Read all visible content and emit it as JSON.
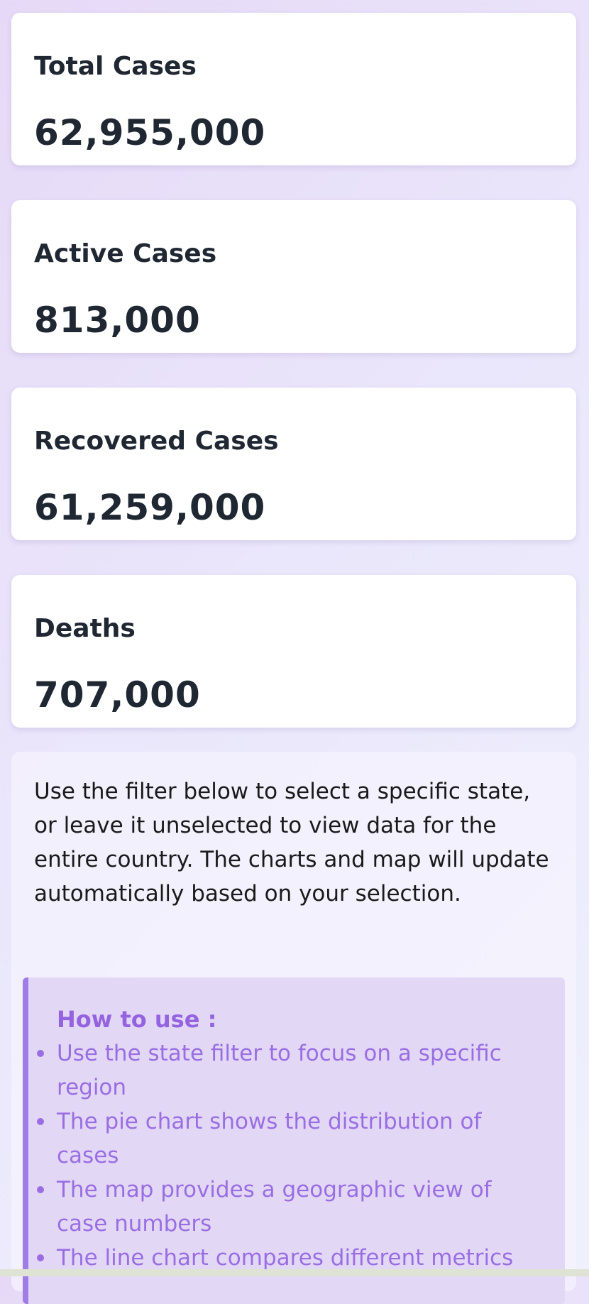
{
  "stats": [
    {
      "label": "Total Cases",
      "value": "62,955,000"
    },
    {
      "label": "Active Cases",
      "value": "813,000"
    },
    {
      "label": "Recovered Cases",
      "value": "61,259,000"
    },
    {
      "label": "Deaths",
      "value": "707,000"
    }
  ],
  "info": {
    "description": "Use the filter below to select a specific state, or leave it unselected to view data for the entire country. The charts and map will update automatically based on your selection.",
    "howto": {
      "title": "How to use :",
      "items": [
        "Use the state filter to focus on a specific region",
        "The pie chart shows the distribution of cases",
        "The map provides a geographic view of case numbers",
        "The line chart compares different metrics"
      ]
    }
  },
  "colors": {
    "card_text": "#1f2733",
    "accent": "#9563e0",
    "howto_background": "#e2d8f6",
    "howto_border": "#a07de6"
  }
}
